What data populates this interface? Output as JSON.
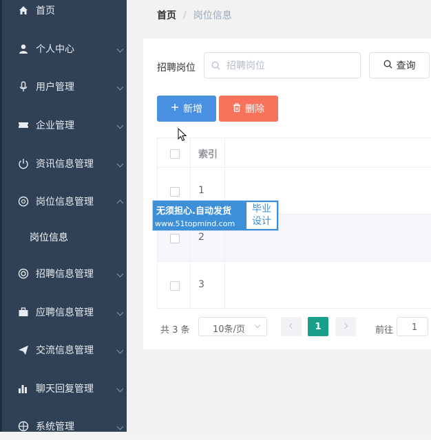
{
  "sidebar": {
    "items": [
      {
        "label": "首页",
        "icon": "home-icon"
      },
      {
        "label": "个人中心",
        "icon": "user-icon"
      },
      {
        "label": "用户管理",
        "icon": "microphone-icon"
      },
      {
        "label": "企业管理",
        "icon": "ticket-icon"
      },
      {
        "label": "资讯信息管理",
        "icon": "power-icon"
      },
      {
        "label": "岗位信息管理",
        "icon": "disc-icon",
        "expanded": true
      },
      {
        "label": "招聘信息管理",
        "icon": "lifebuoy-icon"
      },
      {
        "label": "应聘信息管理",
        "icon": "briefcase-icon"
      },
      {
        "label": "交流信息管理",
        "icon": "paper-plane-icon"
      },
      {
        "label": "聊天回复管理",
        "icon": "bar-chart-icon"
      },
      {
        "label": "系统管理",
        "icon": "globe-icon"
      }
    ],
    "subitem": "岗位信息"
  },
  "breadcrumb": {
    "home": "首页",
    "separator": "/",
    "current": "岗位信息"
  },
  "search": {
    "label": "招聘岗位",
    "placeholder": "招聘岗位",
    "value": "",
    "query_label": "查询"
  },
  "actions": {
    "add_label": "新增",
    "delete_label": "删除"
  },
  "table": {
    "headers": [
      "",
      "索引"
    ],
    "rows": [
      {
        "index": "1"
      },
      {
        "index": "2"
      },
      {
        "index": "3"
      }
    ]
  },
  "pagination": {
    "total": "共 3 条",
    "page_size": "10条/页",
    "current_page": "1",
    "goto_label": "前往",
    "goto_value": "1"
  },
  "watermark": {
    "line1": "无须担心.自动发货",
    "line2": "www.51topmind.com",
    "badge_top": "毕业",
    "badge_bottom": "设计"
  },
  "colors": {
    "sidebar_bg": "#304156",
    "primary": "#4a90e2",
    "danger": "#f7735b",
    "pager_active": "#18a08a"
  }
}
